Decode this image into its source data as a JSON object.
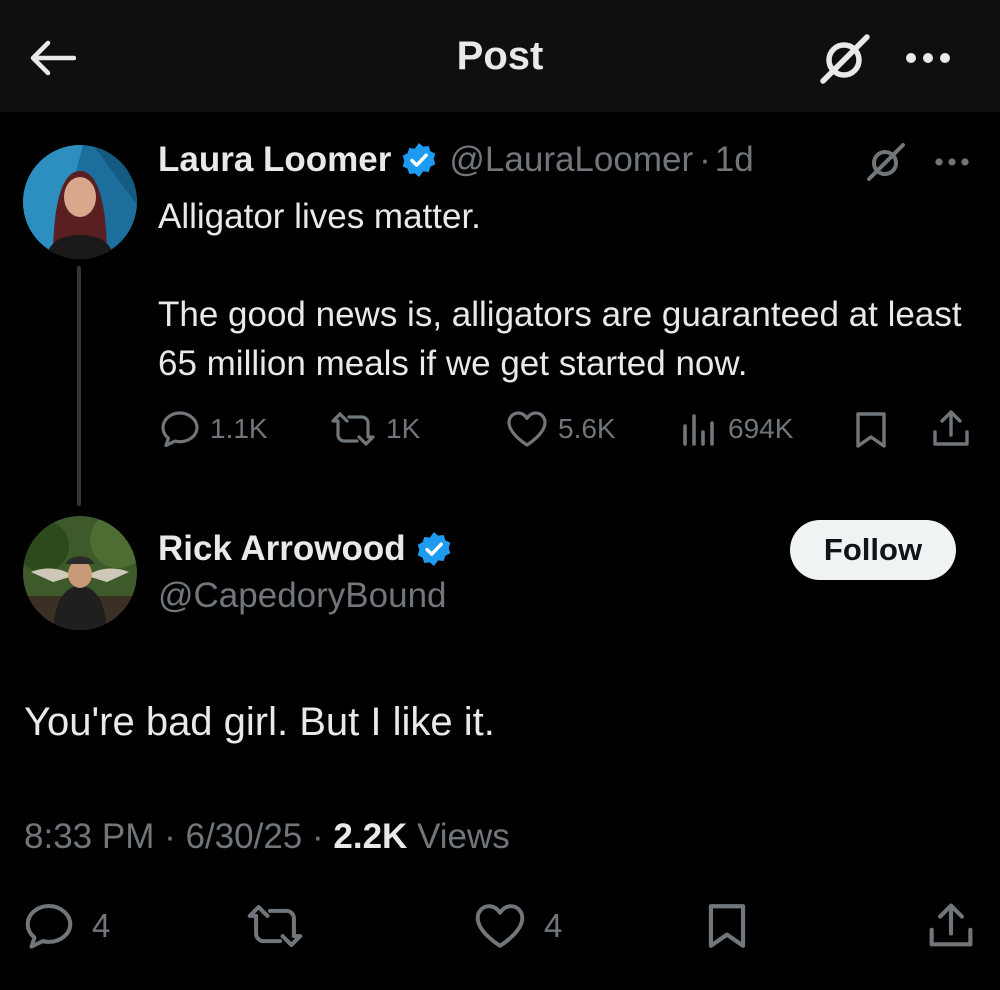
{
  "header": {
    "title": "Post",
    "back_icon": "arrow-left-icon",
    "grok_icon": "grok-icon",
    "more_icon": "more-horizontal-icon"
  },
  "colors": {
    "background": "#000000",
    "header_bg": "#0f0f0f",
    "text": "#e7e9ea",
    "muted": "#71767b",
    "verified": "#1d9bf0",
    "follow_bg": "#eff3f4"
  },
  "parent_post": {
    "author_name": "Laura Loomer",
    "handle": "@LauraLoomer",
    "separator": "·",
    "time": "1d",
    "text_line1": "Alligator lives matter.",
    "text_para2": "The good news is, alligators are guaranteed at least 65 million meals if we get started now.",
    "stats": {
      "replies": "1.1K",
      "reposts": "1K",
      "likes": "5.6K",
      "views": "694K"
    }
  },
  "reply_post": {
    "author_name": "Rick Arrowood",
    "handle": "@CapedoryBound",
    "follow_label": "Follow",
    "text": "You're bad girl. But I like it.",
    "time": "8:33 PM",
    "separator": "·",
    "date": "6/30/25",
    "views_count": "2.2K",
    "views_label": "Views",
    "stats": {
      "replies": "4",
      "likes": "4"
    }
  }
}
